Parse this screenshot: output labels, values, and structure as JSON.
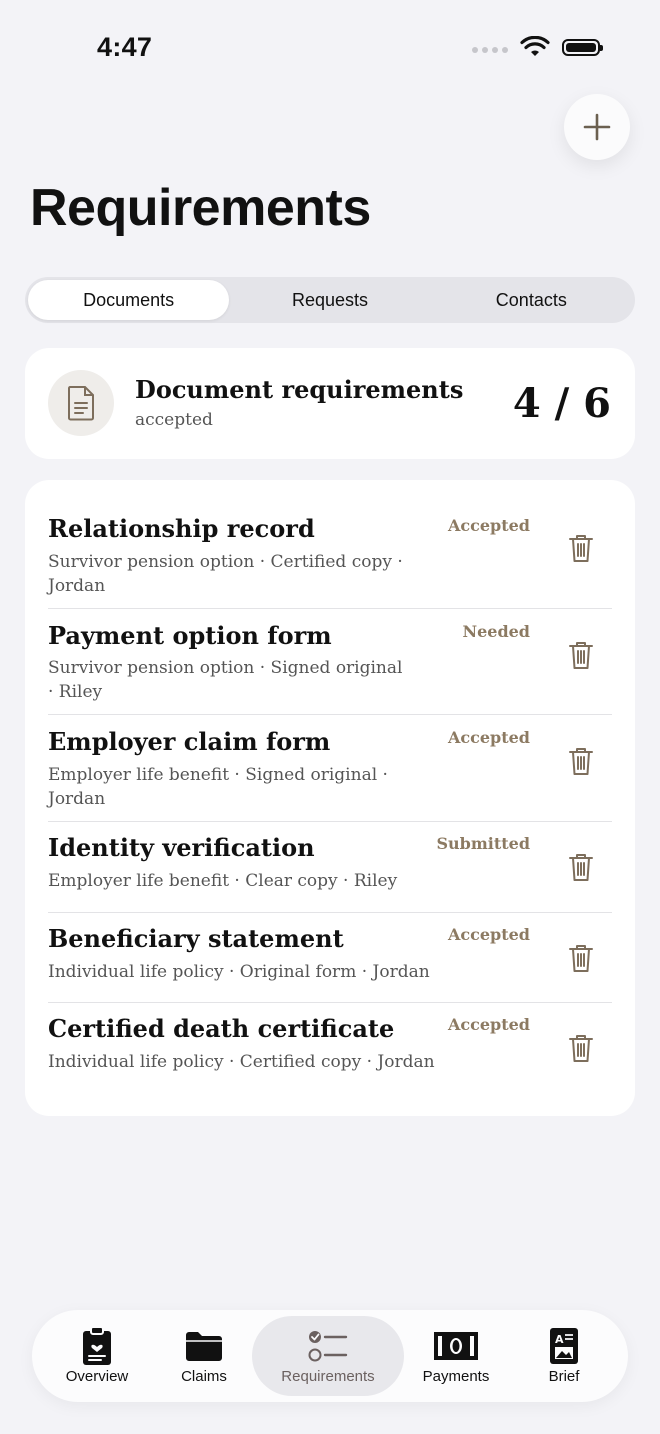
{
  "status_bar": {
    "time": "4:47"
  },
  "header": {
    "title": "Requirements",
    "add_icon": "plus-icon"
  },
  "segments": [
    {
      "label": "Documents",
      "active": true
    },
    {
      "label": "Requests",
      "active": false
    },
    {
      "label": "Contacts",
      "active": false
    }
  ],
  "summary": {
    "title": "Document requirements",
    "subtitle": "accepted",
    "count": "4 / 6",
    "icon": "document-icon"
  },
  "requirements": [
    {
      "title": "Relationship record",
      "meta": "Survivor pension option · Certified copy · Jordan",
      "status": "Accepted"
    },
    {
      "title": "Payment option form",
      "meta": "Survivor pension option · Signed original · Riley",
      "status": "Needed"
    },
    {
      "title": "Employer claim form",
      "meta": "Employer life benefit · Signed original · Jordan",
      "status": "Accepted"
    },
    {
      "title": "Identity verification",
      "meta": "Employer life benefit · Clear copy · Riley",
      "status": "Submitted"
    },
    {
      "title": "Beneficiary statement",
      "meta": "Individual life policy · Original form · Jordan",
      "status": "Accepted"
    },
    {
      "title": "Certified death certificate",
      "meta": "Individual life policy · Certified copy · Jordan",
      "status": "Accepted"
    }
  ],
  "tabs": [
    {
      "label": "Overview",
      "icon": "clipboard-heart-icon",
      "active": false
    },
    {
      "label": "Claims",
      "icon": "folder-icon",
      "active": false
    },
    {
      "label": "Requirements",
      "icon": "checklist-icon",
      "active": true
    },
    {
      "label": "Payments",
      "icon": "banknote-icon",
      "active": false
    },
    {
      "label": "Brief",
      "icon": "brief-document-icon",
      "active": false
    }
  ],
  "colors": {
    "background": "#f3f3f7",
    "status_accent": "#8c7a62",
    "card": "#ffffff"
  }
}
